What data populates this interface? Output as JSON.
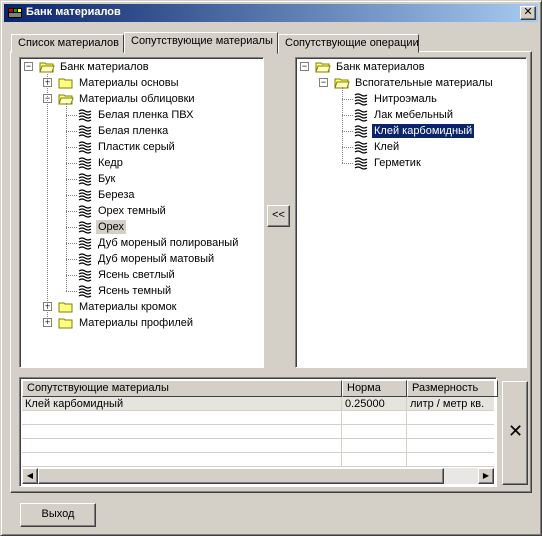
{
  "window": {
    "title": "Банк материалов",
    "close_symbol": "✕"
  },
  "tabs": [
    {
      "label": "Список материалов",
      "active": false
    },
    {
      "label": "Сопутствующие материалы",
      "active": true
    },
    {
      "label": "Сопутствующие операции",
      "active": false
    }
  ],
  "left_tree": {
    "root": "Банк материалов",
    "groups": [
      {
        "label": "Материалы основы",
        "expanded": false
      },
      {
        "label": "Материалы облицовки",
        "expanded": true
      },
      {
        "label": "Материалы кромок",
        "expanded": false
      },
      {
        "label": "Материалы профилей",
        "expanded": false
      }
    ],
    "items": [
      "Белая пленка ПВХ",
      "Белая пленка",
      "Пластик серый",
      "Кедр",
      "Бук",
      "Береза",
      "Орех темный",
      "Орех",
      "Дуб мореный полированый",
      "Дуб мореный матовый",
      "Ясень светлый",
      "Ясень темный"
    ],
    "highlighted_item": "Орех"
  },
  "right_tree": {
    "root": "Банк материалов",
    "group": "Вспогательные материалы",
    "items": [
      "Нитроэмаль",
      "Лак мебельный",
      "Клей карбомидный",
      "Клей",
      "Герметик"
    ],
    "selected_item": "Клей карбомидный"
  },
  "move_button": {
    "label": "<<"
  },
  "grid": {
    "columns": [
      "Сопутствующие материалы",
      "Норма",
      "Размерность"
    ],
    "rows": [
      {
        "material": "Клей карбомидный",
        "norm": "0.25000",
        "unit": "литр / метр кв."
      }
    ]
  },
  "delete_button": {
    "label": "✕"
  },
  "exit_button": {
    "label": "Выход"
  },
  "colors": {
    "title_start": "#0a246a",
    "title_end": "#a6caf0",
    "face": "#d4d0c8",
    "selection": "#0a246a"
  }
}
